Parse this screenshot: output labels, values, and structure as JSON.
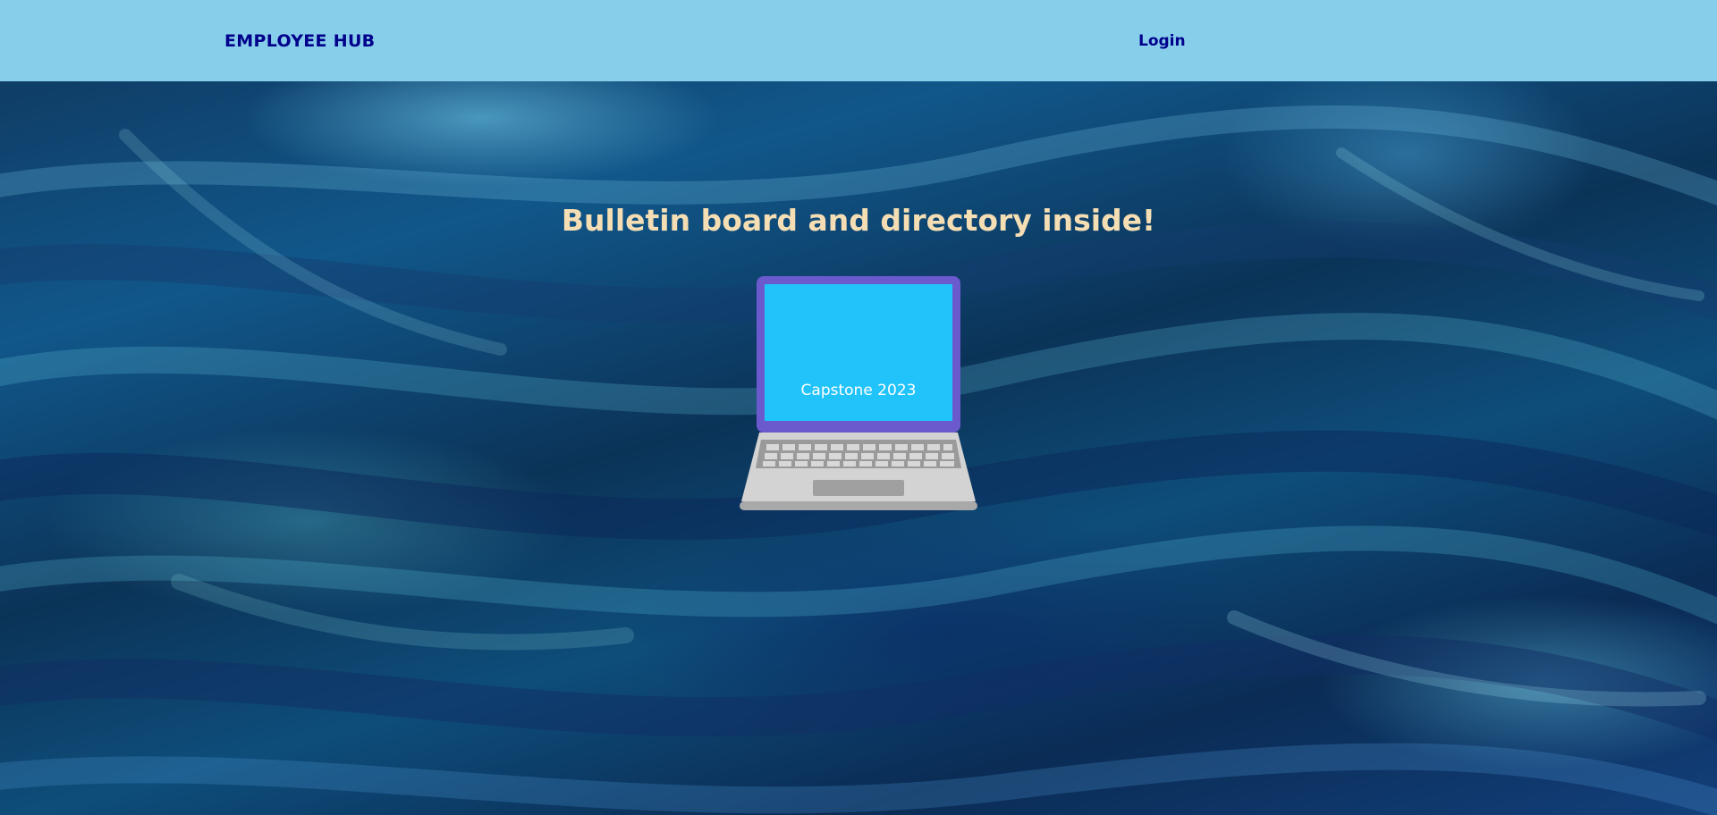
{
  "navbar": {
    "brand": "EMPLOYEE HUB",
    "login_label": "Login"
  },
  "hero": {
    "headline": "Bulletin board and directory inside!",
    "laptop_screen_text": "Capstone 2023"
  },
  "icons": {
    "laptop": "laptop-icon"
  },
  "colors": {
    "navbar_bg": "#87ceeb",
    "nav_text": "#00008b",
    "headline": "#f5deb3",
    "laptop_frame": "#6a5acd",
    "laptop_screen": "#21c3fb"
  }
}
